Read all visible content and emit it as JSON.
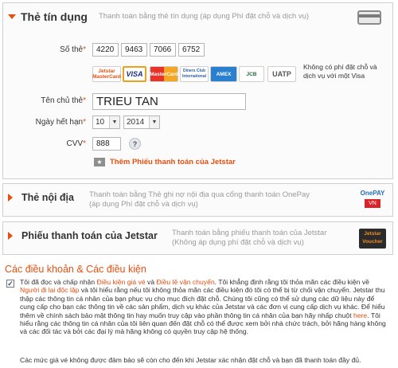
{
  "credit": {
    "title": "Thẻ tín dụng",
    "description": "Thanh toán bằng thẻ tín dụng (áp dụng Phí đặt chỗ và dịch vụ)",
    "card_number_label": "Số thẻ",
    "card_number_parts": [
      "4220",
      "9463",
      "7066",
      "6752"
    ],
    "card_logos": [
      "Jetstar MasterCard",
      "VISA",
      "MasterCard",
      "Diners Club International",
      "AMEX",
      "JCB",
      "UATP"
    ],
    "fee_note": "Không có phí đặt chỗ và dịch vụ với một Visa",
    "holder_label": "Tên chủ thẻ",
    "holder_value": "TRIEU TAN",
    "expiry_label": "Ngày hết hạn",
    "expiry_month": "10",
    "expiry_year": "2014",
    "cvv_label": "CVV",
    "cvv_value": "888",
    "help_label": "?",
    "required_mark": "*",
    "voucher_link": "Thêm Phiếu thanh toán của Jetstar"
  },
  "domestic": {
    "title": "Thẻ nội địa",
    "description": "Thanh toán bằng Thẻ ghi nợ nội địa qua cổng thanh toán OnePay (áp dụng Phí đặt chỗ và dịch vụ)",
    "logo_top": "OnePAY",
    "logo_bottom": "VN"
  },
  "voucher": {
    "title": "Phiếu thanh toán của Jetstar",
    "description": "Thanh toán bằng phiếu thanh toán của Jetstar (Không áp dụng phí đặt chỗ và dịch vụ)",
    "logo_text": "Jetstar Voucher"
  },
  "terms": {
    "title": "Các điều khoản & Các điều kiện",
    "checked_mark": "✓",
    "p1": "Tôi đã đọc và chấp nhận ",
    "link1": "Điều kiện giá vé",
    "p2": " và ",
    "link2": "Điều lệ vận chuyển",
    "p3": ". Tôi khẳng định rằng tôi thỏa mãn các điều kiện về ",
    "link3": "Người đi lại độc lập",
    "p4": " và tôi hiểu rằng nếu tôi không thỏa mãn các điều kiện đó tôi có thể bị từ chối vận chuyển. Jetstar thu thập các thông tin cá nhân của bạn phục vụ cho mục đích đặt chỗ. Chúng tôi cũng có thể sử dụng các dữ liệu này để cung cấp cho bạn các thông tin về các sản phẩm, dịch vụ khác của Jetstar và các đơn vị cung cấp dịch vụ khác. Để hiểu thêm về chính sách bảo mật thông tin hay muốn truy cập vào phần thông tin cá nhân của bạn hãy nhấp chuột ",
    "link4": "here",
    "p5": ". Tôi hiểu rằng các thông tin cá nhân của tôi liên quan đến đặt chỗ có thể được xem bởi nhà chức trách, bởi hãng hàng không và các đối tác và bởi các đại lý mà hãng không có quyền truy cập hệ thống.",
    "note": "Các mức giá vé không được đảm bảo sẽ còn cho đến khi Jetstar xác nhận đặt chỗ và bạn đã thanh toán đầy đủ."
  },
  "colors": {
    "accent": "#e84e0f",
    "panel_border": "#cfcfcf",
    "muted_text": "#9a9a9a"
  }
}
